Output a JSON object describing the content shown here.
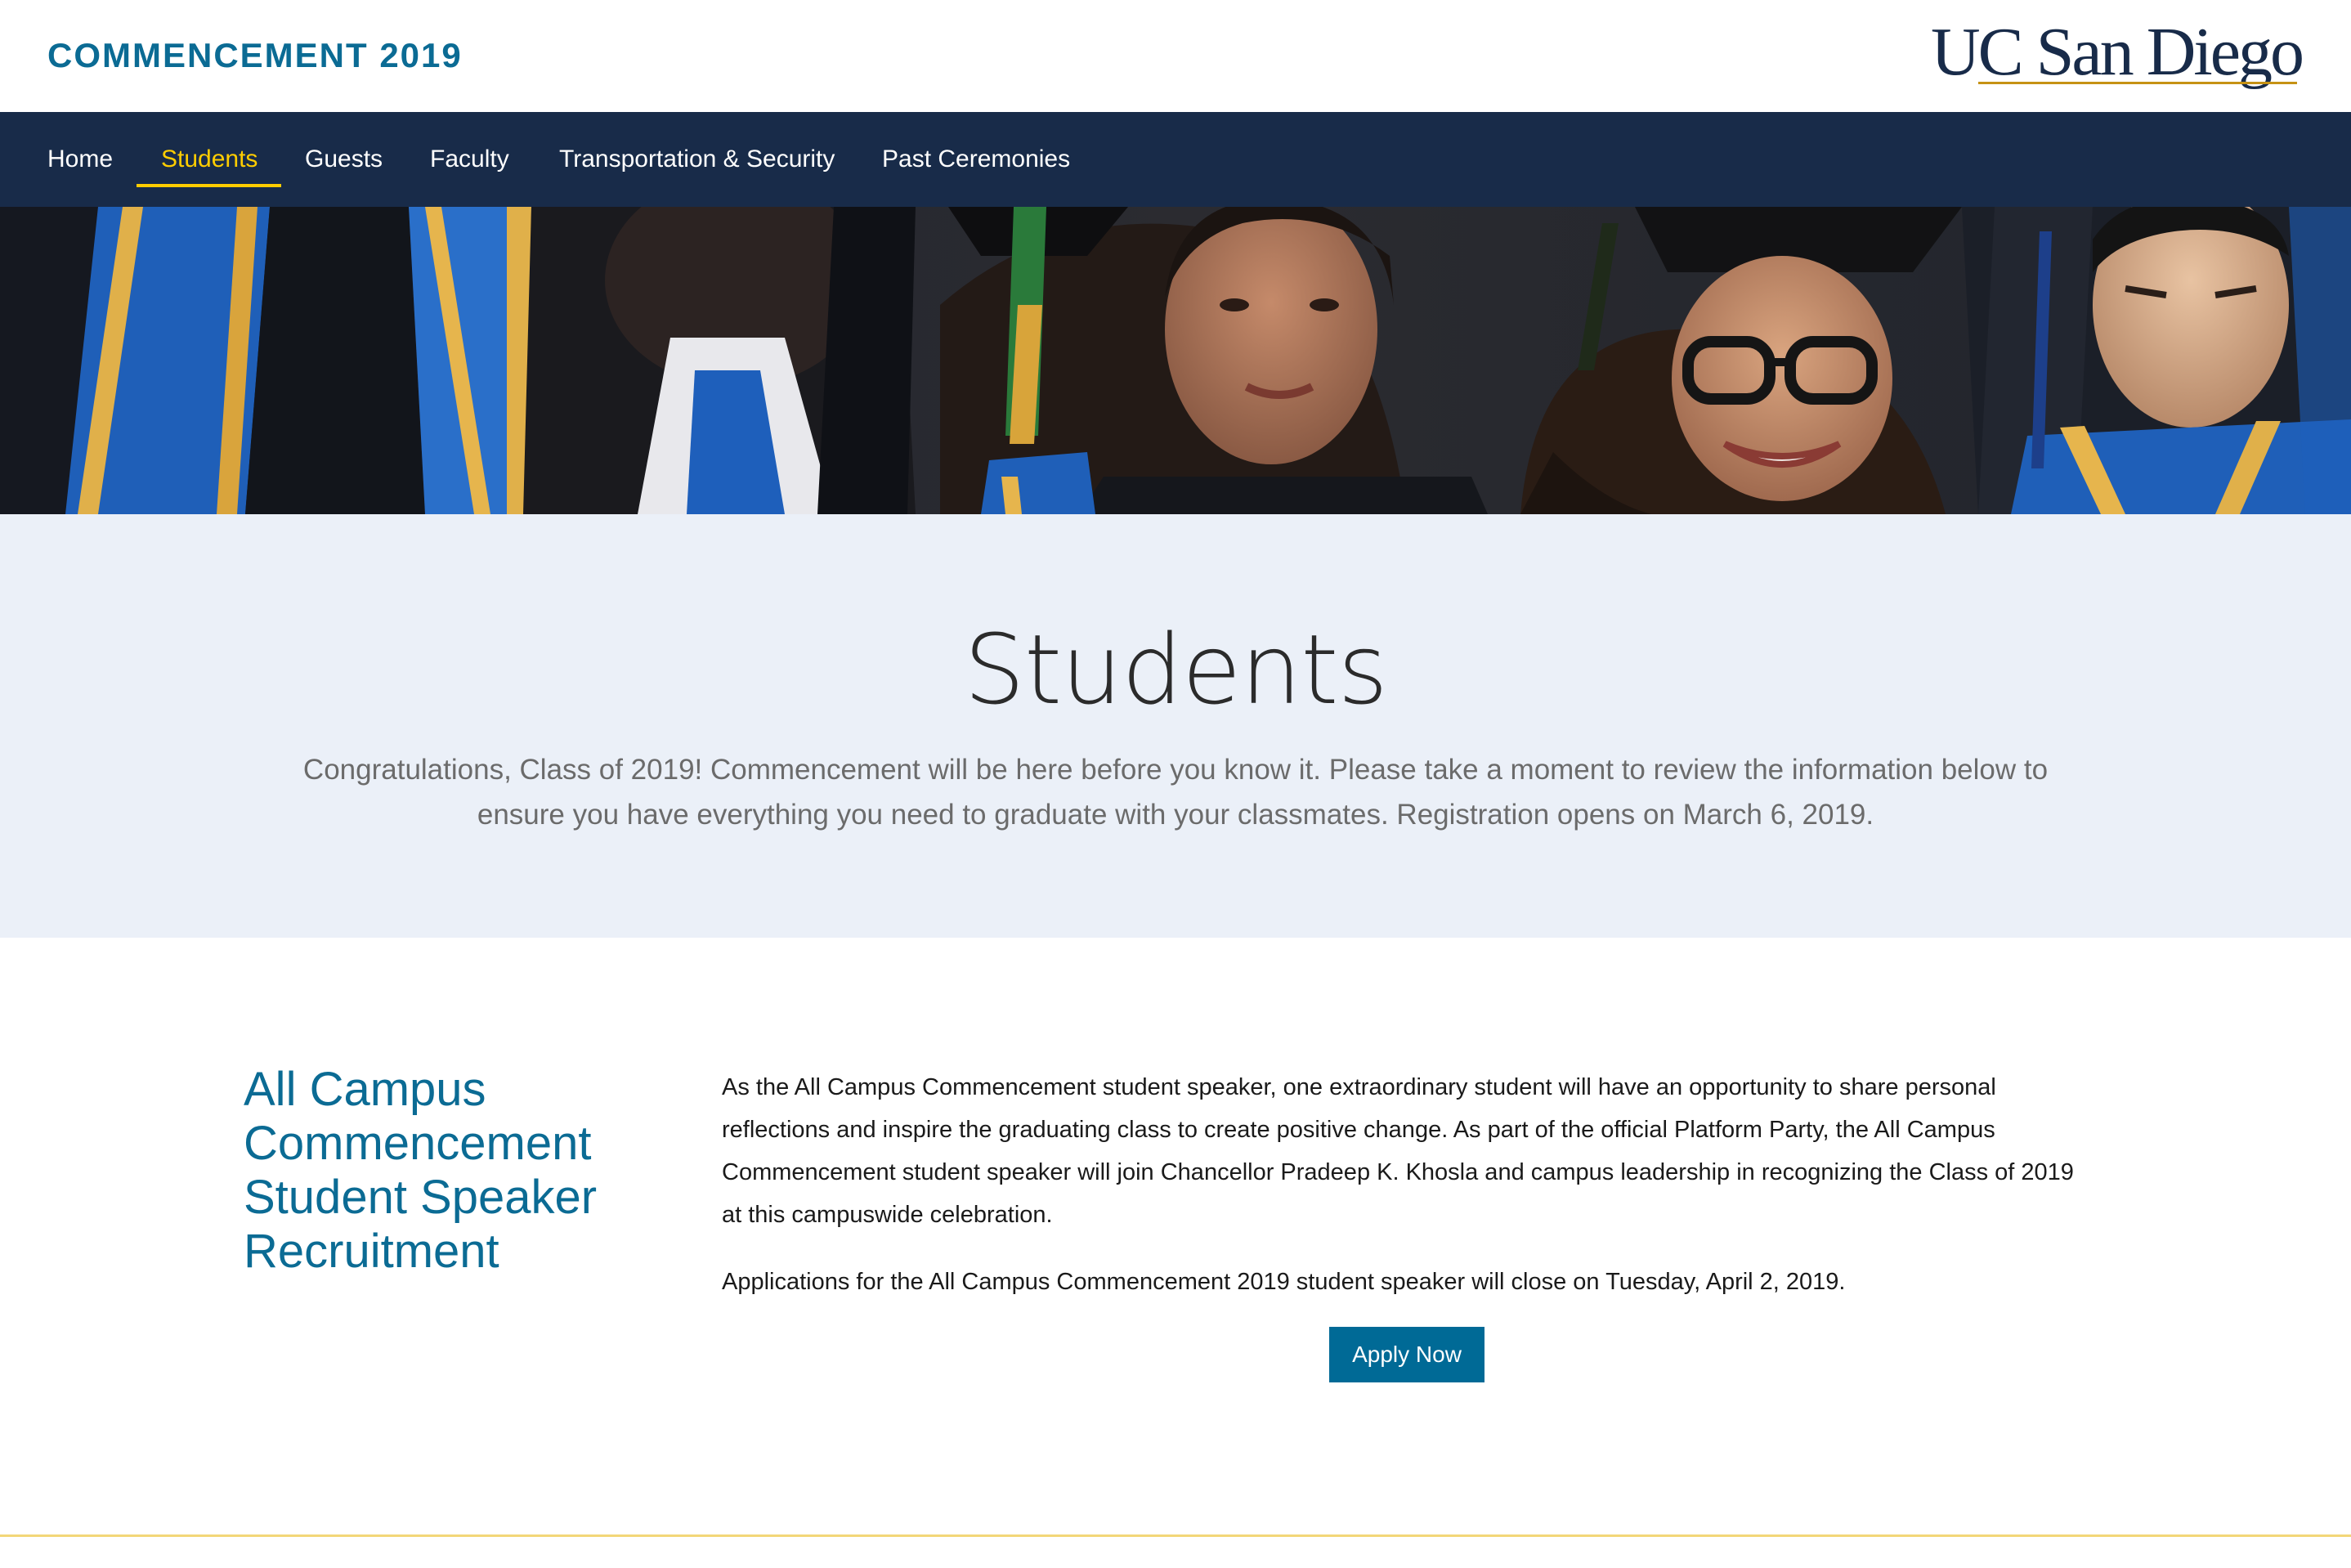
{
  "header": {
    "site_title": "COMMENCEMENT 2019",
    "logo_text": "UC San Diego"
  },
  "nav": {
    "items": [
      {
        "label": "Home",
        "active": false
      },
      {
        "label": "Students",
        "active": true
      },
      {
        "label": "Guests",
        "active": false
      },
      {
        "label": "Faculty",
        "active": false
      },
      {
        "label": "Transportation & Security",
        "active": false
      },
      {
        "label": "Past Ceremonies",
        "active": false
      }
    ]
  },
  "intro": {
    "title": "Students",
    "text": "Congratulations, Class of 2019! Commencement will be here before you know it. Please take a moment to review the information below to ensure you have everything you need to graduate with your classmates. Registration opens on March 6, 2019."
  },
  "section": {
    "heading": "All Campus Commencement Student Speaker Recruitment",
    "paragraphs": [
      "As the All Campus Commencement student speaker, one extraordinary student will have an opportunity to share personal reflections and inspire the graduating class to create positive change. As part of the official Platform Party, the All Campus Commencement student speaker will join Chancellor Pradeep K. Khosla and campus leadership in recognizing the Class of 2019 at this campuswide celebration.",
      "Applications for the All Campus Commencement 2019 student speaker will close on Tuesday, April 2, 2019."
    ],
    "button_label": "Apply Now"
  },
  "colors": {
    "brand_navy": "#182b49",
    "brand_gold": "#ffcd00",
    "accent_blue": "#0b6b94",
    "button_blue": "#006a96",
    "intro_bg": "#ebf0f8"
  }
}
